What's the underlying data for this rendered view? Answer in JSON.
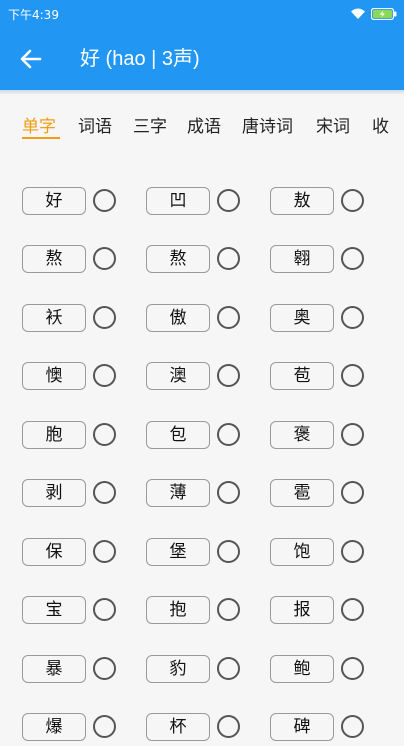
{
  "status": {
    "time": "下午4:39"
  },
  "header": {
    "title": "好 (hao | 3声)"
  },
  "tabs": [
    "单字",
    "词语",
    "三字",
    "成语",
    "唐诗词",
    "宋词",
    "收"
  ],
  "characters": [
    [
      "好",
      "凹",
      "敖"
    ],
    [
      "熬",
      "熬",
      "翱"
    ],
    [
      "袄",
      "傲",
      "奥"
    ],
    [
      "懊",
      "澳",
      "苞"
    ],
    [
      "胞",
      "包",
      "褒"
    ],
    [
      "剥",
      "薄",
      "雹"
    ],
    [
      "保",
      "堡",
      "饱"
    ],
    [
      "宝",
      "抱",
      "报"
    ],
    [
      "暴",
      "豹",
      "鲍"
    ],
    [
      "爆",
      "杯",
      "碑"
    ]
  ],
  "colors": {
    "primary": "#2196f3",
    "accent": "#f39c12"
  }
}
